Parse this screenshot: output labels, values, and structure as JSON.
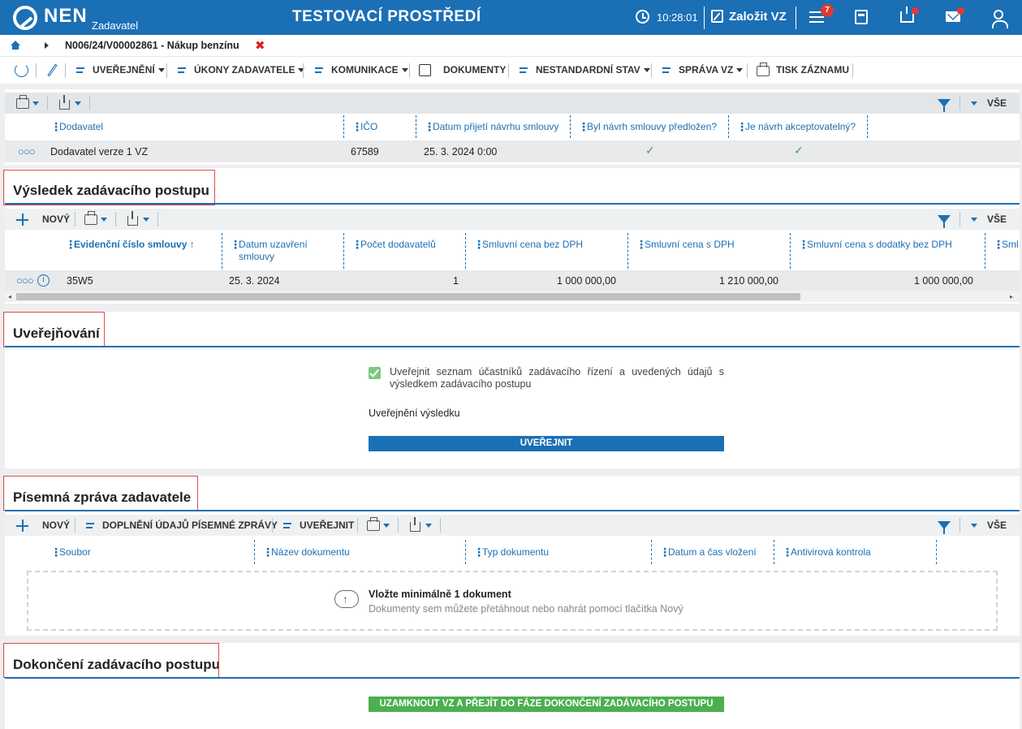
{
  "header": {
    "logo": "NEN",
    "logo_sub": "Zadavatel",
    "environment": "TESTOVACÍ PROSTŘEDÍ",
    "time": "10:28:01",
    "new_vz": "Založit VZ",
    "notifications_count": "7",
    "accent": "#1b6fb5"
  },
  "breadcrumb": {
    "title": "N006/24/V00002861 - Nákup benzínu",
    "close": "✖"
  },
  "toolbar": {
    "items": [
      "UVEŘEJNĚNÍ",
      "ÚKONY ZADAVATELE",
      "KOMUNIKACE",
      "DOKUMENTY",
      "NESTANDARDNÍ STAV",
      "SPRÁVA VZ",
      "TISK ZÁZNAMU"
    ]
  },
  "suppliers": {
    "vse": "VŠE",
    "columns": [
      "Dodavatel",
      "IČO",
      "Datum přijetí návrhu smlouvy",
      "Byl návrh smlouvy předložen?",
      "Je návrh akceptovatelný?"
    ],
    "row": {
      "dodavatel": "Dodavatel verze 1 VZ",
      "ico": "67589",
      "datum": "25. 3. 2024 0:00",
      "predlozen": "✓",
      "akceptovatelny": "✓"
    }
  },
  "vysledek": {
    "title": "Výsledek zadávacího postupu",
    "new_label": "NOVÝ",
    "vse": "VŠE",
    "columns": [
      "Evidenční číslo smlouvy ↑",
      "Datum uzavření smlouvy",
      "Počet dodavatelů",
      "Smluvní cena bez DPH",
      "Smluvní cena s DPH",
      "Smluvní cena s dodatky bez DPH",
      "Sml"
    ],
    "row": {
      "cislo": "35W5",
      "datum": "25. 3. 2024",
      "pocet": "1",
      "cena_bez": "1 000 000,00",
      "cena_s": "1 210 000,00",
      "cena_dodatky": "1 000 000,00"
    }
  },
  "uverejnovani": {
    "title": "Uveřejňování",
    "checkbox_label": "Uveřejnit seznam účastníků zadávacího řízení a uvedených údajů s výsledkem zadávacího postupu",
    "result_label": "Uveřejnění výsledku",
    "button": "UVEŘEJNIT"
  },
  "pisemna": {
    "title": "Písemná zpráva zadavatele",
    "new_label": "NOVÝ",
    "doplneni": "DOPLNĚNÍ ÚDAJŮ PÍSEMNÉ ZPRÁVY",
    "uverejnit": "UVEŘEJNIT",
    "vse": "VŠE",
    "columns": [
      "Soubor",
      "Název dokumentu",
      "Typ dokumentu",
      "Datum a čas vložení",
      "Antivirová kontrola"
    ],
    "drop_title": "Vložte minimálně 1 dokument",
    "drop_hint": "Dokumenty sem můžete přetáhnout nebo nahrát pomocí tlačítka Nový"
  },
  "dokonceni": {
    "title": "Dokončení zadávacího postupu",
    "button": "UZAMKNOUT VZ A PŘEJÍT DO FÁZE DOKONČENÍ ZADÁVACÍHO POSTUPU",
    "button_color": "#4caf50"
  }
}
